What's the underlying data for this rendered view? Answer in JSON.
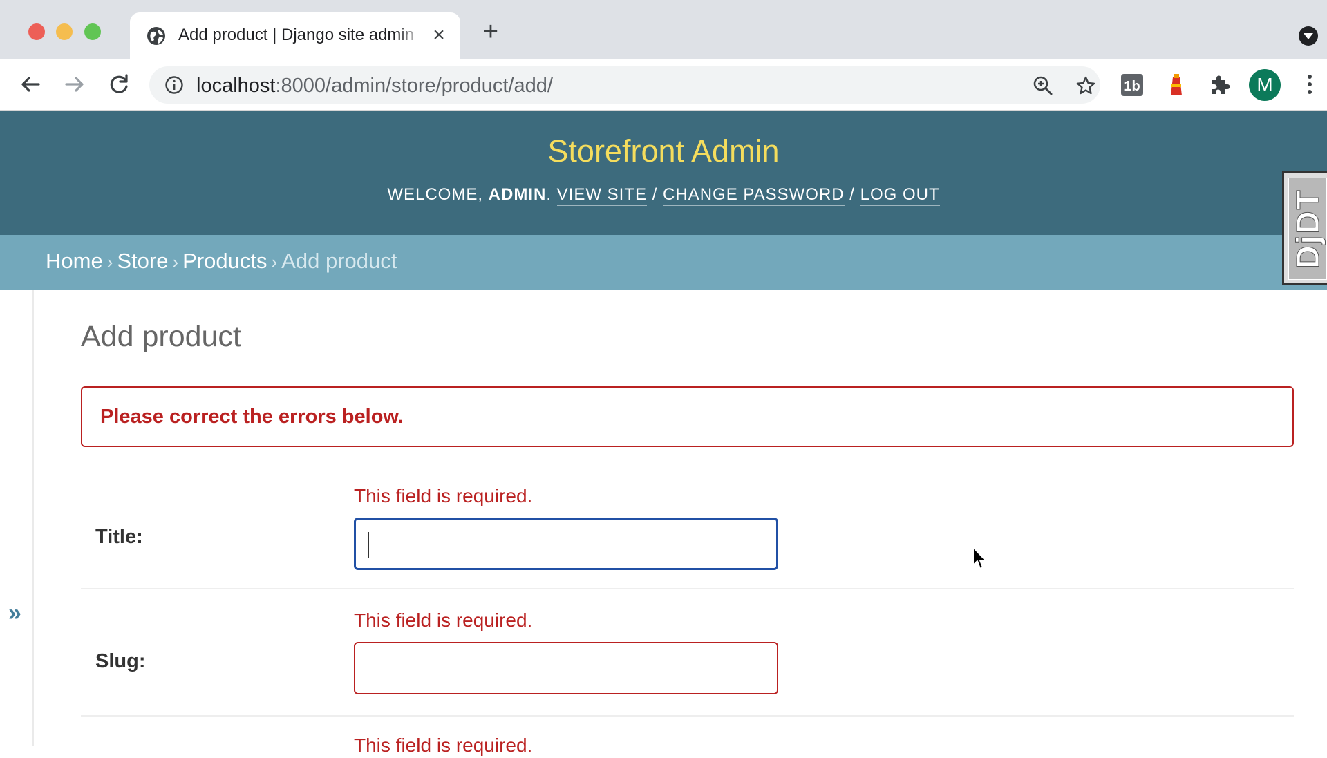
{
  "browser": {
    "tab_title": "Add product | Django site admin",
    "url_host": "localhost",
    "url_path": ":8000/admin/store/product/add/",
    "profile_initial": "M",
    "colors": {
      "tabstrip": "#dee1e6",
      "avatar": "#0c7a5a"
    }
  },
  "header": {
    "site_name": "Storefront Admin",
    "welcome": "Welcome,",
    "username": "admin",
    "view_site": "View site",
    "change_password": "Change password",
    "log_out": "Log out"
  },
  "breadcrumbs": {
    "home": "Home",
    "store": "Store",
    "products": "Products",
    "current": "Add product",
    "separator": "›"
  },
  "djdt_label": "DjDT",
  "sidebar": {
    "toggle_glyph": "»"
  },
  "main": {
    "title": "Add product",
    "error_note": "Please correct the errors below.",
    "fields": [
      {
        "label": "Title:",
        "error": "This field is required.",
        "value": ""
      },
      {
        "label": "Slug:",
        "error": "This field is required.",
        "value": ""
      },
      {
        "error": "This field is required."
      }
    ]
  },
  "colors": {
    "header_bg": "#3d6b7d",
    "site_name": "#f5dd5d",
    "breadcrumbs_bg": "#73a8bb",
    "error": "#ba2121",
    "focus": "#2150a5"
  }
}
